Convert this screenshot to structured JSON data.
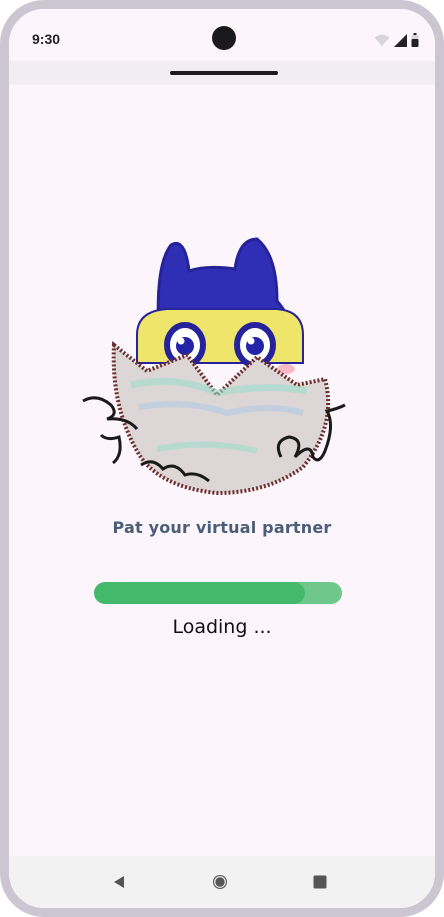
{
  "status_bar": {
    "time": "9:30",
    "icons": [
      "wifi-icon",
      "signal-icon",
      "battery-icon"
    ]
  },
  "splash": {
    "logo_name": "mimichi-logo",
    "tagline": "Pat your virtual partner",
    "progress": 0.85,
    "loading_text": "Loading ..."
  },
  "nav_bar": {
    "buttons": [
      "back-icon",
      "home-icon",
      "recents-icon"
    ]
  },
  "colors": {
    "background": "#fcf5fc",
    "tagline": "#4a5e78",
    "progress_track": "#6fc78b",
    "progress_fill": "#44b96a",
    "mascot_blue": "#2f2fb6",
    "mascot_yellow": "#efe56a"
  }
}
